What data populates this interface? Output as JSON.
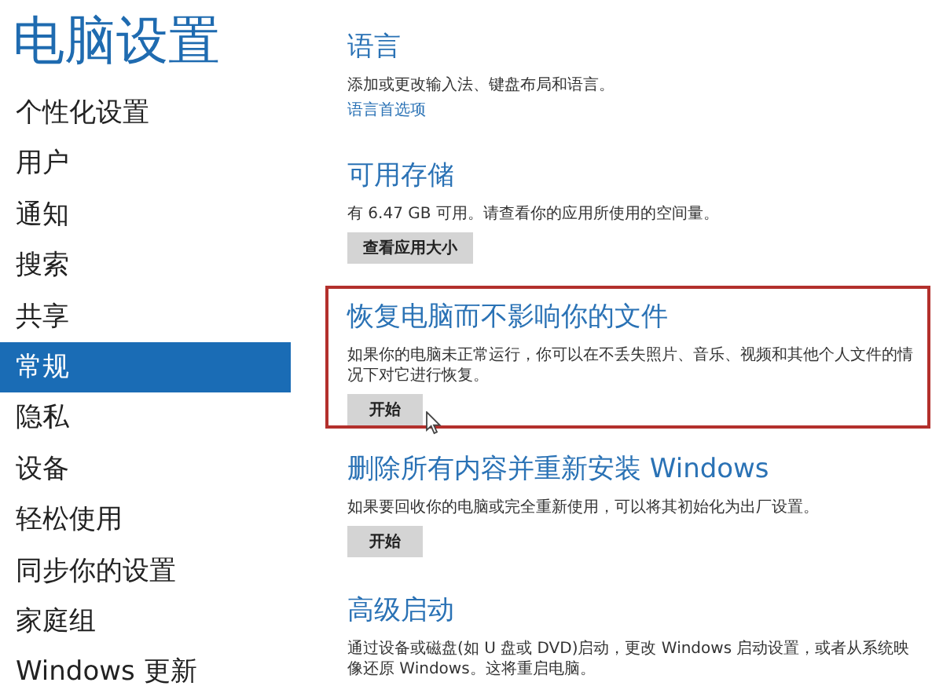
{
  "sidebar": {
    "title": "电脑设置",
    "items": [
      {
        "label": "个性化设置",
        "selected": false
      },
      {
        "label": "用户",
        "selected": false
      },
      {
        "label": "通知",
        "selected": false
      },
      {
        "label": "搜索",
        "selected": false
      },
      {
        "label": "共享",
        "selected": false
      },
      {
        "label": "常规",
        "selected": true
      },
      {
        "label": "隐私",
        "selected": false
      },
      {
        "label": "设备",
        "selected": false
      },
      {
        "label": "轻松使用",
        "selected": false
      },
      {
        "label": "同步你的设置",
        "selected": false
      },
      {
        "label": "家庭组",
        "selected": false
      },
      {
        "label": "Windows 更新",
        "selected": false
      }
    ]
  },
  "sections": [
    {
      "heading": "语言",
      "description": "添加或更改输入法、键盘布局和语言。",
      "link": "语言首选项"
    },
    {
      "heading": "可用存储",
      "description": "有 6.47 GB 可用。请查看你的应用所使用的空间量。",
      "button": "查看应用大小"
    },
    {
      "heading": "恢复电脑而不影响你的文件",
      "description": "如果你的电脑未正常运行，你可以在不丢失照片、音乐、视频和其他个人文件的情况下对它进行恢复。",
      "button": "开始",
      "highlighted": true
    },
    {
      "heading": "删除所有内容并重新安装 Windows",
      "description": "如果要回收你的电脑或完全重新使用，可以将其初始化为出厂设置。",
      "button": "开始"
    },
    {
      "heading": "高级启动",
      "description": "通过设备或磁盘(如 U 盘或 DVD)启动，更改 Windows 启动设置，或者从系统映像还原 Windows。这将重启电脑。"
    }
  ]
}
